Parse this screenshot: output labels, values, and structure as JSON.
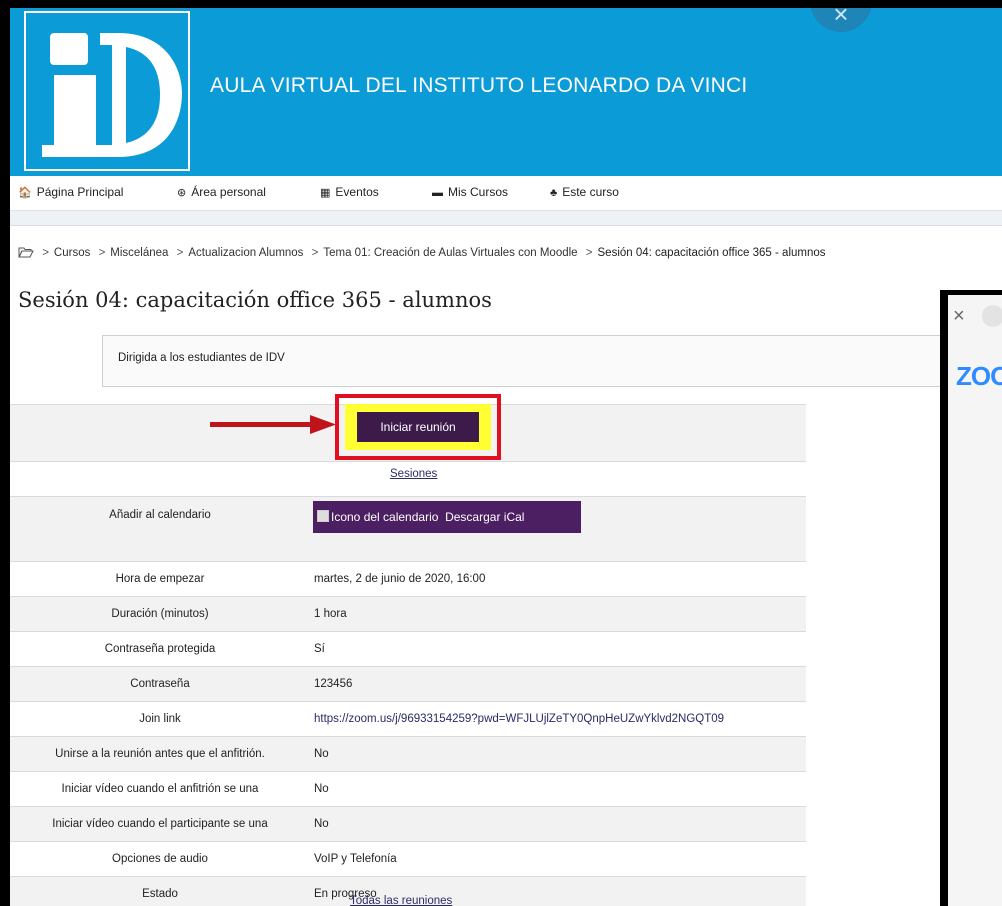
{
  "header": {
    "site_title": "AULA VIRTUAL DEL INSTITUTO LEONARDO DA VINCI",
    "logo_text": "iD",
    "close_glyph": "×"
  },
  "nav": [
    {
      "icon": "home-icon",
      "glyph": "🏠",
      "label": "Página Principal"
    },
    {
      "icon": "dashboard-icon",
      "glyph": "⊛",
      "label": "Área personal"
    },
    {
      "icon": "calendar-icon",
      "glyph": "▦",
      "label": "Eventos"
    },
    {
      "icon": "courses-icon",
      "glyph": "▬",
      "label": "Mis Cursos"
    },
    {
      "icon": "sitemap-icon",
      "glyph": "♣",
      "label": "Este curso"
    }
  ],
  "breadcrumb": [
    "Cursos",
    "Miscelánea",
    "Actualizacion Alumnos",
    "Tema 01: Creación de Aulas Virtuales con Moodle",
    "Sesión 04: capacitación office 365 - alumnos"
  ],
  "page": {
    "title": "Sesión 04: capacitación office 365 - alumnos",
    "description": "Dirigida a los estudiantes de IDV"
  },
  "meeting": {
    "start_button": "Iniciar reunión",
    "sessions_link": "Sesiones",
    "ical_alt": "Icono del calendario",
    "ical_label": "Descargar iCal",
    "all_meetings_link": "Todas las reuniones",
    "rows": [
      {
        "label": "Añadir al calendario",
        "value": ""
      },
      {
        "label": "Hora de empezar",
        "value": "martes, 2 de junio de 2020, 16:00"
      },
      {
        "label": "Duración (minutos)",
        "value": "1 hora"
      },
      {
        "label": "Contraseña protegida",
        "value": "Sí"
      },
      {
        "label": "Contraseña",
        "value": "123456"
      },
      {
        "label": "Join link",
        "value": "https://zoom.us/j/96933154259?pwd=WFJLUjlZeTY0QnpHeUZwYklvd2NGQT09"
      },
      {
        "label": "Unirse a la reunión antes que el anfitrión.",
        "value": "No"
      },
      {
        "label": "Iniciar vídeo cuando el anfitrión se una",
        "value": "No"
      },
      {
        "label": "Iniciar vídeo cuando el participante se una",
        "value": "No"
      },
      {
        "label": "Opciones de audio",
        "value": "VoIP y Telefonía"
      },
      {
        "label": "Estado",
        "value": "En progreso"
      }
    ]
  },
  "popup": {
    "close_glyph": "×",
    "brand_partial": "ZOO"
  },
  "colors": {
    "header": "#0b9bd6",
    "button": "#3c1a49",
    "highlight_border": "#e01020",
    "highlight_fill": "#ffff33",
    "arrow": "#c0141c"
  }
}
